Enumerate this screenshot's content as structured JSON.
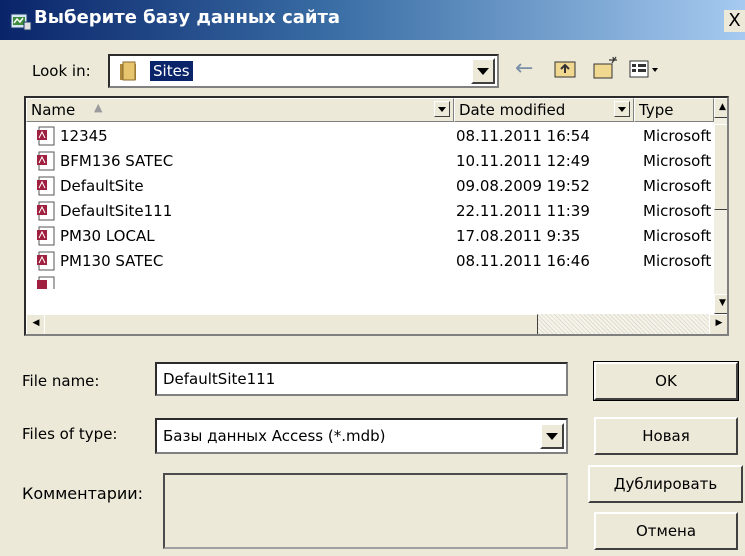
{
  "window": {
    "title": "Выберите базу данных сайта",
    "close_glyph": "X"
  },
  "look_in": {
    "label": "Look in:",
    "value": "Sites"
  },
  "toolbar": {
    "icons": [
      "back-icon",
      "up-folder-icon",
      "new-folder-icon",
      "views-menu-icon"
    ]
  },
  "file_list": {
    "columns": [
      "Name",
      "Date modified",
      "Type"
    ],
    "rows": [
      {
        "name": "12345",
        "date": "08.11.2011 16:54",
        "type": "Microsoft"
      },
      {
        "name": "BFM136 SATEC",
        "date": "10.11.2011 12:49",
        "type": "Microsoft"
      },
      {
        "name": "DefaultSite",
        "date": "09.08.2009 19:52",
        "type": "Microsoft"
      },
      {
        "name": "DefaultSite111",
        "date": "22.11.2011 11:39",
        "type": "Microsoft"
      },
      {
        "name": "PM30 LOCAL",
        "date": "17.08.2011 9:35",
        "type": "Microsoft"
      },
      {
        "name": "PM130 SATEC",
        "date": "08.11.2011 16:46",
        "type": "Microsoft"
      }
    ]
  },
  "file_name": {
    "label": "File name:",
    "value": "DefaultSite111"
  },
  "file_type": {
    "label": "Files of type:",
    "value": "Базы данных Access (*.mdb)"
  },
  "comment": {
    "label": "Комментарии:",
    "value": ""
  },
  "buttons": {
    "ok": "OK",
    "new": "Новая",
    "duplicate": "Дублировать",
    "cancel": "Отмена"
  },
  "colors": {
    "title_bar": "#0a246a",
    "dialog_bg": "#ece9d8",
    "selection": "#0a246a"
  }
}
